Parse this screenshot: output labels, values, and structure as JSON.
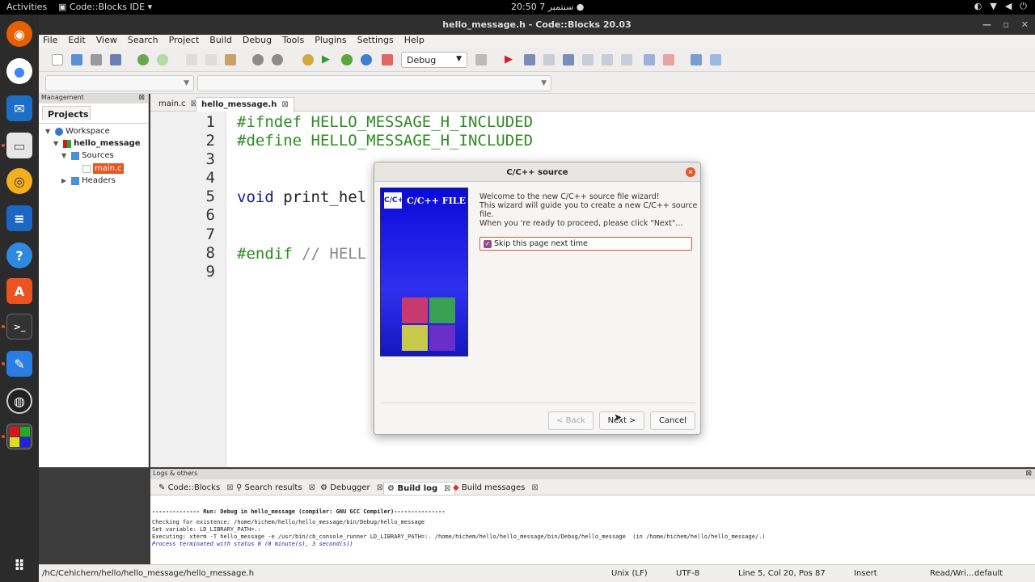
{
  "topbar": {
    "activities": "Activities",
    "app_name": "Code::Blocks IDE",
    "clock": "20:50  سبتمبر 7"
  },
  "window": {
    "title": "hello_message.h - Code::Blocks 20.03"
  },
  "menu": [
    "File",
    "Edit",
    "View",
    "Search",
    "Project",
    "Build",
    "Debug",
    "Tools",
    "Plugins",
    "Settings",
    "Help"
  ],
  "toolbar": {
    "build_target": "Debug"
  },
  "management": {
    "header": "Management",
    "tab": "Projects",
    "tree": {
      "workspace": "Workspace",
      "project": "hello_message",
      "sources": "Sources",
      "file": "main.c",
      "headers": "Headers"
    }
  },
  "editor": {
    "tabs": [
      "main.c",
      "hello_message.h"
    ],
    "line_numbers": [
      "1",
      "2",
      "3",
      "4",
      "5",
      "6",
      "7",
      "8",
      "9"
    ],
    "lines": {
      "l1": "#ifndef HELLO_MESSAGE_H_INCLUDED",
      "l2": "#define HELLO_MESSAGE_H_INCLUDED",
      "l5_kw": "void",
      "l5_rest": " print_hel",
      "l8_pp": "#endif",
      "l8_cm": " // HELL"
    }
  },
  "dialog": {
    "title": "C/C++ source",
    "banner_logo": "C/C++",
    "banner_title": "C/C++ FILE",
    "welcome": "Welcome to the new C/C++ source file wizard!",
    "guide": "This wizard will guide you to create a new C/C++ source file.",
    "proceed": "When you 're ready to proceed, please click \"Next\"...",
    "skip_label": "Skip this page next time",
    "skip_checked": true,
    "back": "< Back",
    "next": "Next >",
    "cancel": "Cancel",
    "close": "×"
  },
  "logs": {
    "header": "Logs & others",
    "tabs": [
      "Code::Blocks",
      "Search results",
      "Debugger",
      "Build log",
      "Build messages"
    ],
    "lines": [
      "-------------- Run: Debug in hello_message (compiler: GNU GCC Compiler)---------------",
      "Checking for existence: /home/hichem/hello/hello_message/bin/Debug/hello_message",
      "Set variable: LD_LIBRARY_PATH=.:",
      "Executing: xterm -T hello_message -e /usr/bin/cb_console_runner LD_LIBRARY_PATH=:. /home/hichem/hello/hello_message/bin/Debug/hello_message  (in /home/hichem/hello/hello_message/.)",
      "Process terminated with status 0 (0 minute(s), 3 second(s))"
    ]
  },
  "status": {
    "path": "/hC/Cehichem/hello/hello_message/hello_message.h",
    "eol": "Unix (LF)",
    "encoding": "UTF-8",
    "position": "Line 5, Col 20, Pos 87",
    "mode": "Insert",
    "access": "Read/Wri...",
    "profile": "default"
  },
  "colors": {
    "accent": "#e95420",
    "dock_bg": "#2b2b2b",
    "preprocessor": "#2e8b22",
    "keyword": "#1a1a8c"
  }
}
